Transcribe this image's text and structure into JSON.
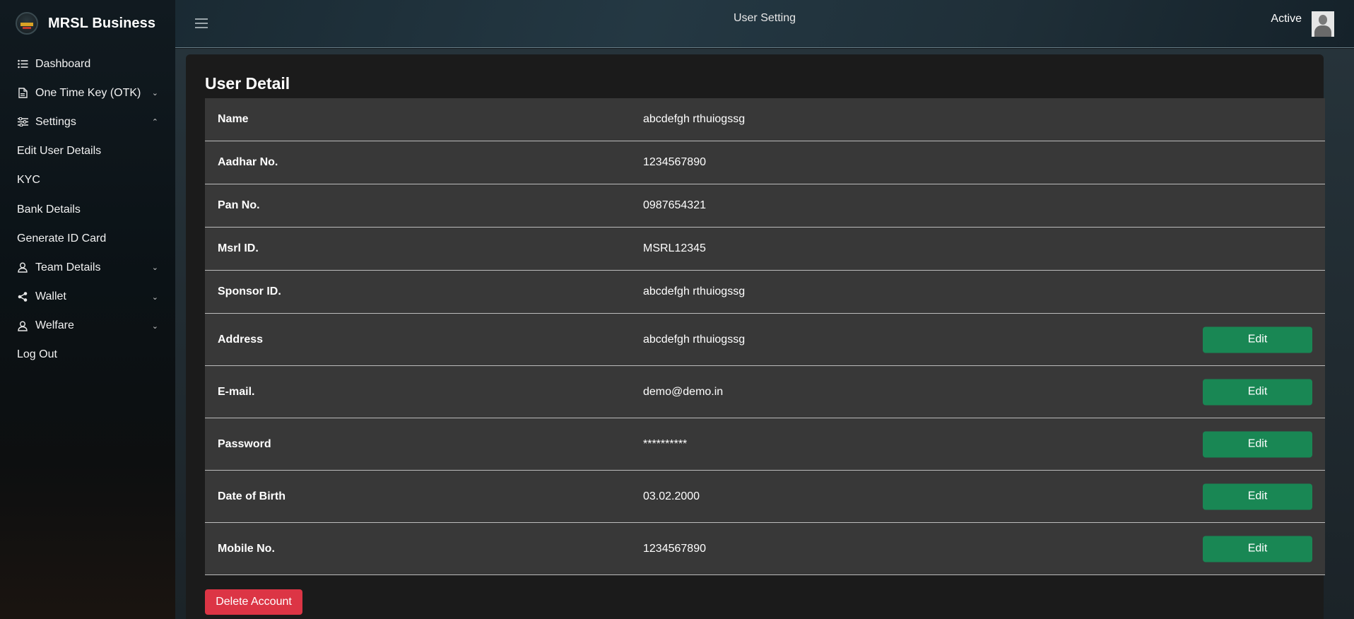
{
  "brand": {
    "name": "MRSL Business"
  },
  "sidebar": {
    "items": [
      {
        "label": "Dashboard",
        "icon": "list-icon",
        "chevron": ""
      },
      {
        "label": "One Time Key (OTK)",
        "icon": "document-icon",
        "chevron": "⌄"
      },
      {
        "label": "Settings",
        "icon": "sliders-icon",
        "chevron": "⌃"
      },
      {
        "label": "Edit User Details",
        "icon": "",
        "chevron": ""
      },
      {
        "label": "KYC",
        "icon": "",
        "chevron": ""
      },
      {
        "label": "Bank Details",
        "icon": "",
        "chevron": ""
      },
      {
        "label": "Generate ID Card",
        "icon": "",
        "chevron": ""
      },
      {
        "label": "Team Details",
        "icon": "user-icon",
        "chevron": "⌄"
      },
      {
        "label": "Wallet",
        "icon": "share-icon",
        "chevron": "⌄"
      },
      {
        "label": "Welfare",
        "icon": "user-icon",
        "chevron": "⌄"
      },
      {
        "label": "Log Out",
        "icon": "",
        "chevron": ""
      }
    ]
  },
  "topbar": {
    "title": "User Setting",
    "status": "Active"
  },
  "main": {
    "title": "User Detail",
    "rows": [
      {
        "label": "Name",
        "value": "abcdefgh rthuiogssg",
        "edit": ""
      },
      {
        "label": "Aadhar No.",
        "value": "1234567890",
        "edit": ""
      },
      {
        "label": "Pan No.",
        "value": "0987654321",
        "edit": ""
      },
      {
        "label": "Msrl ID.",
        "value": "MSRL12345",
        "edit": ""
      },
      {
        "label": "Sponsor ID.",
        "value": "abcdefgh rthuiogssg",
        "edit": ""
      },
      {
        "label": "Address",
        "value": "abcdefgh rthuiogssg",
        "edit": "Edit"
      },
      {
        "label": "E-mail.",
        "value": "demo@demo.in",
        "edit": "Edit"
      },
      {
        "label": "Password",
        "value": "**********",
        "edit": "Edit"
      },
      {
        "label": "Date of Birth",
        "value": "03.02.2000",
        "edit": "Edit"
      },
      {
        "label": "Mobile No.",
        "value": "1234567890",
        "edit": "Edit"
      }
    ],
    "delete_label": "Delete Account"
  },
  "colors": {
    "edit_button": "#198754",
    "delete_button": "#dc3545",
    "row_background": "#383838",
    "card_background": "#1b1b1b"
  }
}
